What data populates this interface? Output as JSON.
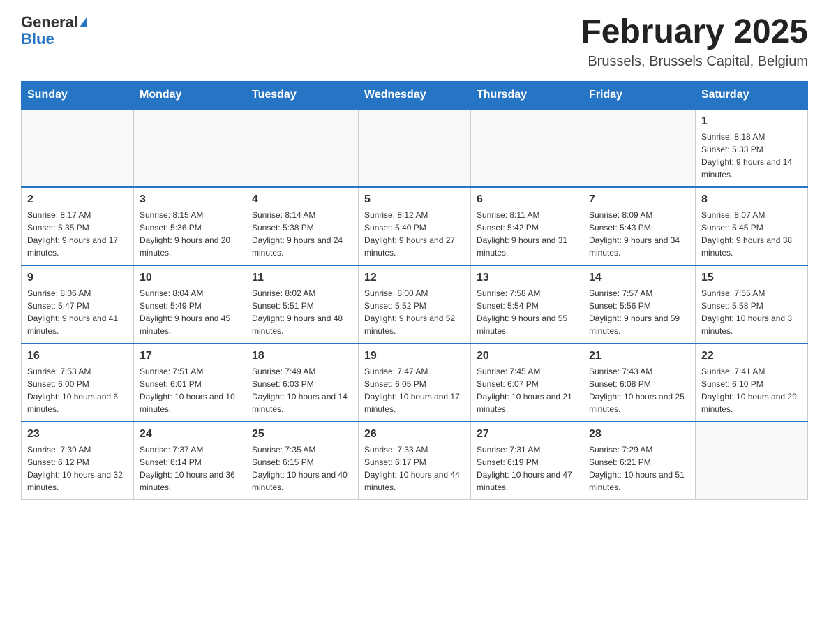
{
  "logo": {
    "general": "General",
    "blue": "Blue",
    "tagline": "General Blue"
  },
  "calendar": {
    "title": "February 2025",
    "subtitle": "Brussels, Brussels Capital, Belgium",
    "days_of_week": [
      "Sunday",
      "Monday",
      "Tuesday",
      "Wednesday",
      "Thursday",
      "Friday",
      "Saturday"
    ],
    "weeks": [
      [
        {
          "day": "",
          "info": ""
        },
        {
          "day": "",
          "info": ""
        },
        {
          "day": "",
          "info": ""
        },
        {
          "day": "",
          "info": ""
        },
        {
          "day": "",
          "info": ""
        },
        {
          "day": "",
          "info": ""
        },
        {
          "day": "1",
          "info": "Sunrise: 8:18 AM\nSunset: 5:33 PM\nDaylight: 9 hours and 14 minutes."
        }
      ],
      [
        {
          "day": "2",
          "info": "Sunrise: 8:17 AM\nSunset: 5:35 PM\nDaylight: 9 hours and 17 minutes."
        },
        {
          "day": "3",
          "info": "Sunrise: 8:15 AM\nSunset: 5:36 PM\nDaylight: 9 hours and 20 minutes."
        },
        {
          "day": "4",
          "info": "Sunrise: 8:14 AM\nSunset: 5:38 PM\nDaylight: 9 hours and 24 minutes."
        },
        {
          "day": "5",
          "info": "Sunrise: 8:12 AM\nSunset: 5:40 PM\nDaylight: 9 hours and 27 minutes."
        },
        {
          "day": "6",
          "info": "Sunrise: 8:11 AM\nSunset: 5:42 PM\nDaylight: 9 hours and 31 minutes."
        },
        {
          "day": "7",
          "info": "Sunrise: 8:09 AM\nSunset: 5:43 PM\nDaylight: 9 hours and 34 minutes."
        },
        {
          "day": "8",
          "info": "Sunrise: 8:07 AM\nSunset: 5:45 PM\nDaylight: 9 hours and 38 minutes."
        }
      ],
      [
        {
          "day": "9",
          "info": "Sunrise: 8:06 AM\nSunset: 5:47 PM\nDaylight: 9 hours and 41 minutes."
        },
        {
          "day": "10",
          "info": "Sunrise: 8:04 AM\nSunset: 5:49 PM\nDaylight: 9 hours and 45 minutes."
        },
        {
          "day": "11",
          "info": "Sunrise: 8:02 AM\nSunset: 5:51 PM\nDaylight: 9 hours and 48 minutes."
        },
        {
          "day": "12",
          "info": "Sunrise: 8:00 AM\nSunset: 5:52 PM\nDaylight: 9 hours and 52 minutes."
        },
        {
          "day": "13",
          "info": "Sunrise: 7:58 AM\nSunset: 5:54 PM\nDaylight: 9 hours and 55 minutes."
        },
        {
          "day": "14",
          "info": "Sunrise: 7:57 AM\nSunset: 5:56 PM\nDaylight: 9 hours and 59 minutes."
        },
        {
          "day": "15",
          "info": "Sunrise: 7:55 AM\nSunset: 5:58 PM\nDaylight: 10 hours and 3 minutes."
        }
      ],
      [
        {
          "day": "16",
          "info": "Sunrise: 7:53 AM\nSunset: 6:00 PM\nDaylight: 10 hours and 6 minutes."
        },
        {
          "day": "17",
          "info": "Sunrise: 7:51 AM\nSunset: 6:01 PM\nDaylight: 10 hours and 10 minutes."
        },
        {
          "day": "18",
          "info": "Sunrise: 7:49 AM\nSunset: 6:03 PM\nDaylight: 10 hours and 14 minutes."
        },
        {
          "day": "19",
          "info": "Sunrise: 7:47 AM\nSunset: 6:05 PM\nDaylight: 10 hours and 17 minutes."
        },
        {
          "day": "20",
          "info": "Sunrise: 7:45 AM\nSunset: 6:07 PM\nDaylight: 10 hours and 21 minutes."
        },
        {
          "day": "21",
          "info": "Sunrise: 7:43 AM\nSunset: 6:08 PM\nDaylight: 10 hours and 25 minutes."
        },
        {
          "day": "22",
          "info": "Sunrise: 7:41 AM\nSunset: 6:10 PM\nDaylight: 10 hours and 29 minutes."
        }
      ],
      [
        {
          "day": "23",
          "info": "Sunrise: 7:39 AM\nSunset: 6:12 PM\nDaylight: 10 hours and 32 minutes."
        },
        {
          "day": "24",
          "info": "Sunrise: 7:37 AM\nSunset: 6:14 PM\nDaylight: 10 hours and 36 minutes."
        },
        {
          "day": "25",
          "info": "Sunrise: 7:35 AM\nSunset: 6:15 PM\nDaylight: 10 hours and 40 minutes."
        },
        {
          "day": "26",
          "info": "Sunrise: 7:33 AM\nSunset: 6:17 PM\nDaylight: 10 hours and 44 minutes."
        },
        {
          "day": "27",
          "info": "Sunrise: 7:31 AM\nSunset: 6:19 PM\nDaylight: 10 hours and 47 minutes."
        },
        {
          "day": "28",
          "info": "Sunrise: 7:29 AM\nSunset: 6:21 PM\nDaylight: 10 hours and 51 minutes."
        },
        {
          "day": "",
          "info": ""
        }
      ]
    ]
  }
}
